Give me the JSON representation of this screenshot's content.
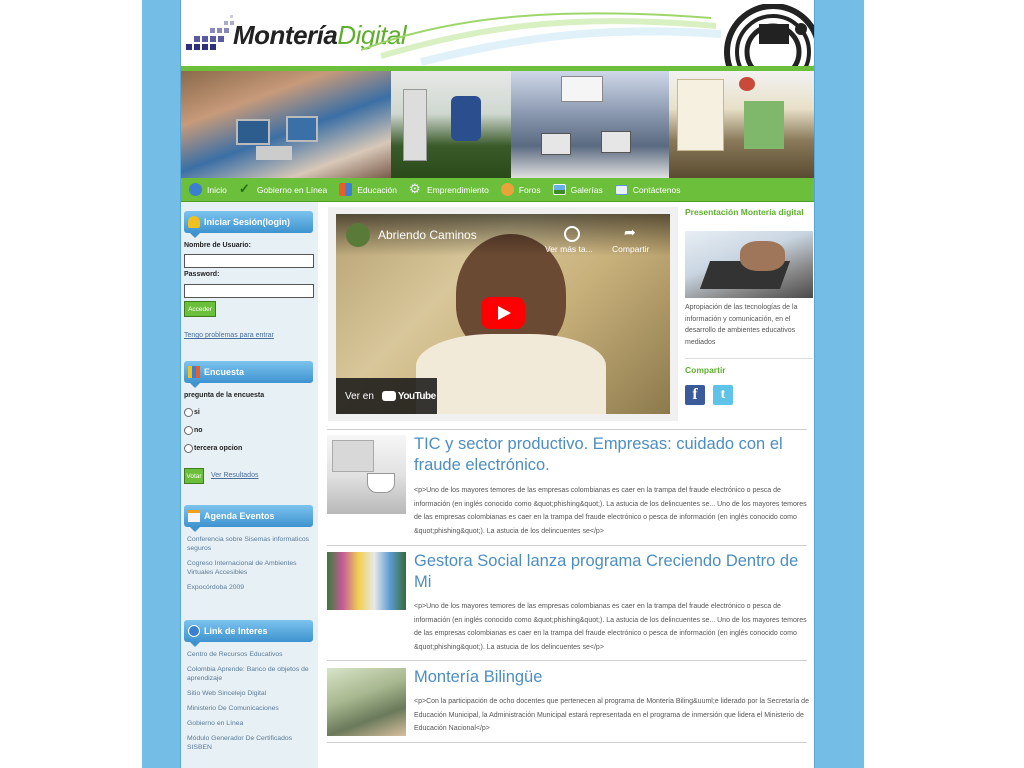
{
  "site": {
    "logo_bold": "Montería",
    "logo_light": "Digital"
  },
  "nav": {
    "items": [
      {
        "label": "Inicio",
        "icon": "globe-icon",
        "color": "#3a7fd0"
      },
      {
        "label": "Gobierno en Línea",
        "icon": "checkmark-icon",
        "color": "#2f8a1f"
      },
      {
        "label": "Educación",
        "icon": "blocks-icon",
        "color": "#e85d2a"
      },
      {
        "label": "Emprendimiento",
        "icon": "gear-icon",
        "color": "#7a8fa8"
      },
      {
        "label": "Foros",
        "icon": "people-icon",
        "color": "#e8a33a"
      },
      {
        "label": "Galerías",
        "icon": "picture-icon",
        "color": "#4a8cc8"
      },
      {
        "label": "Contáctenos",
        "icon": "mail-icon",
        "color": "#5f9ad6"
      }
    ]
  },
  "login": {
    "header": "Iniciar Sesión(login)",
    "username_label": "Nombre de Usuario:",
    "username_value": "",
    "password_label": "Password:",
    "password_value": "",
    "submit_label": "Acceder",
    "problems_link": "Tengo problemas para entrar"
  },
  "poll": {
    "header": "Encuesta",
    "question": "pregunta de la encuesta",
    "options": [
      "si",
      "no",
      "tercera opcion"
    ],
    "vote_label": "Votar",
    "results_link": "Ver Resultados"
  },
  "agenda": {
    "header": "Agenda Eventos",
    "items": [
      "Conferencia sobre Sisemas informaticos seguros",
      "Cogreso Internacional de Ambientes Virtuales Accesibles",
      "Expocórdoba 2009"
    ]
  },
  "links": {
    "header": "Link de Interes",
    "items": [
      "Centro de Recursos Educativos",
      "Colombia Aprende: Banco de objetos de aprendizaje",
      "Sitio Web Sincelejo Digital",
      "Ministerio De Comunicaciones",
      "Gobierno en Línea",
      "Módulo Generador De Certificados SISBEN"
    ]
  },
  "video": {
    "title": "Abriendo Caminos",
    "watch_later": "Ver más ta...",
    "share": "Compartir",
    "watch_on": "Ver en",
    "platform": "YouTube"
  },
  "presentation": {
    "title": "Presentación Montería digital",
    "text": "Apropiación de las tecnologías de la información y comunicación, en el desarrollo de ambientes educativos mediados",
    "share_label": "Compartir"
  },
  "articles": [
    {
      "title": "TIC y sector productivo. Empresas: cuidado con el fraude electrónico.",
      "body": "<p>Uno de los mayores temores de las empresas colombianas es caer en la trampa del fraude electrónico o pesca de información (en inglés conocido como &quot;phishing&quot;). La astucia de los delincuentes se... Uno de los mayores temores de las empresas colombianas es caer en la trampa del fraude electrónico o pesca de información (en inglés conocido como &quot;phishing&quot;). La astucia de los delincuentes se</p>"
    },
    {
      "title": "Gestora Social lanza programa Creciendo Dentro de Mi",
      "body": "<p>Uno de los mayores temores de las empresas colombianas es caer en la trampa del fraude electrónico o pesca de información (en inglés conocido como &quot;phishing&quot;). La astucia de los delincuentes se... Uno de los mayores temores de las empresas colombianas es caer en la trampa del fraude electrónico o pesca de información (en inglés conocido como &quot;phishing&quot;). La astucia de los delincuentes se</p>"
    },
    {
      "title": "Montería Bilingüe",
      "body": "<p>Con la participación de ocho docentes que pertenecen al programa de Montería Biling&uuml;e liderado por la Secretaría de Educación Municipal, la Administración Municipal estará representada en el programa de inmersión que lidera el Ministerio de Educación Nacional</p>"
    }
  ]
}
